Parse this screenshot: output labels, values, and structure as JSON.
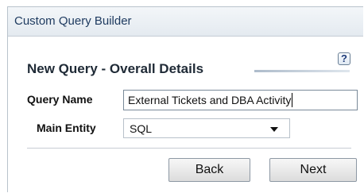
{
  "window": {
    "title": "Custom Query Builder"
  },
  "section": {
    "title": "New Query - Overall Details",
    "help_icon": "help-icon",
    "help_glyph": "?"
  },
  "form": {
    "query_name_label": "Query Name",
    "query_name_value": "External Tickets and DBA Activity",
    "main_entity_label": "Main Entity",
    "main_entity_value": "SQL"
  },
  "buttons": {
    "back_label": "Back",
    "next_label": "Next"
  }
}
